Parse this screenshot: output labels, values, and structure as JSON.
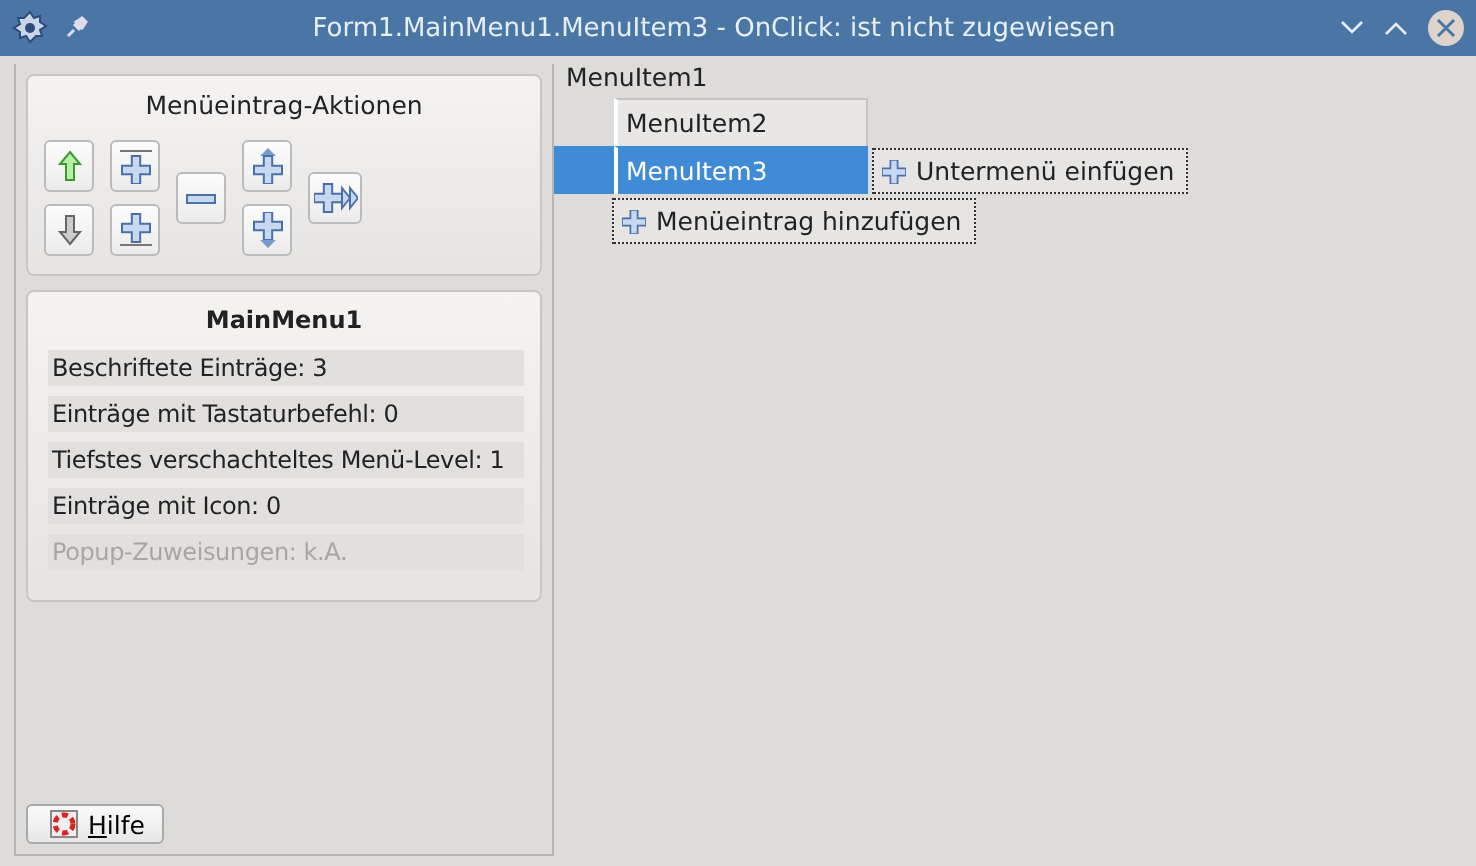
{
  "window": {
    "title": "Form1.MainMenu1.MenuItem3 - OnClick: ist nicht zugewiesen"
  },
  "actions": {
    "title": "Menüeintrag-Aktionen",
    "buttons": [
      {
        "kind": "move-up"
      },
      {
        "kind": "move-down"
      },
      {
        "kind": "insert-before"
      },
      {
        "kind": "insert-after"
      },
      {
        "kind": "delete"
      },
      {
        "kind": "add-above"
      },
      {
        "kind": "add-below"
      },
      {
        "kind": "add-submenu"
      }
    ]
  },
  "stats": {
    "title": "MainMenu1",
    "rows": [
      {
        "text": "Beschriftete Einträge: 3",
        "disabled": false
      },
      {
        "text": "Einträge mit Tastaturbefehl: 0",
        "disabled": false
      },
      {
        "text": "Tiefstes verschachteltes Menü-Level: 1",
        "disabled": false
      },
      {
        "text": "Einträge mit Icon: 0",
        "disabled": false
      },
      {
        "text": "Popup-Zuweisungen: k.A.",
        "disabled": true
      }
    ]
  },
  "help_button": {
    "label": "Hilfe",
    "mnemonic": true
  },
  "designer": {
    "top_item": "MenuItem1",
    "items": [
      {
        "label": "MenuItem2",
        "selected": false
      },
      {
        "label": "MenuItem3",
        "selected": true
      }
    ],
    "add_submenu": "Untermenü einfügen",
    "add_item": "Menüeintrag hinzufügen"
  }
}
